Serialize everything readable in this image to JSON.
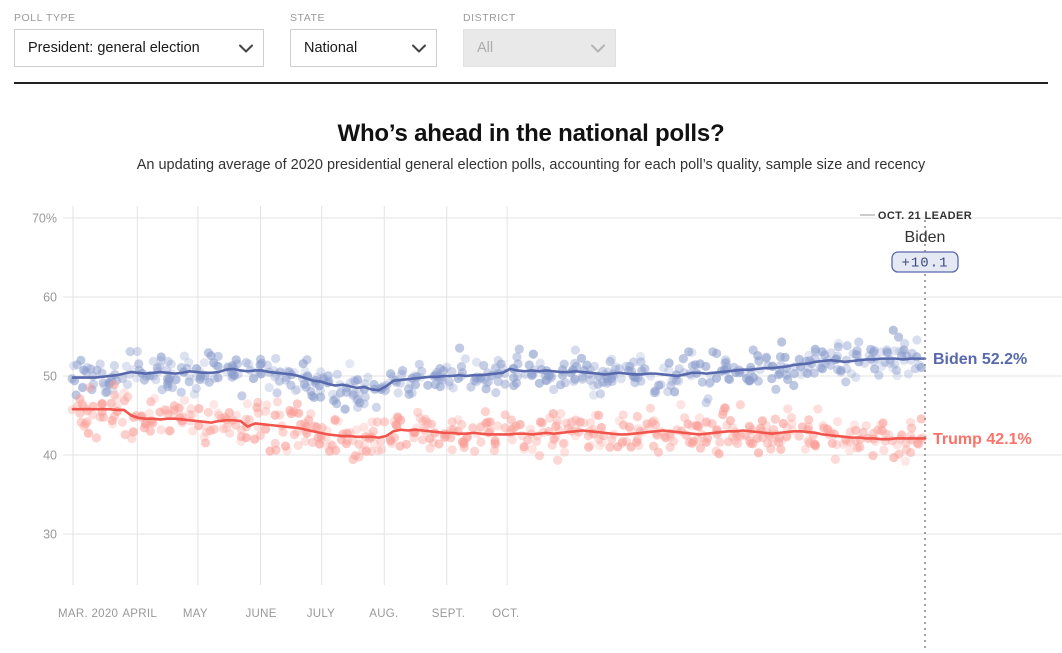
{
  "controls": [
    {
      "label": "POLL TYPE",
      "value": "President: general election",
      "disabled": false,
      "name": "poll-type"
    },
    {
      "label": "STATE",
      "value": "National",
      "disabled": false,
      "name": "state"
    },
    {
      "label": "DISTRICT",
      "value": "All",
      "disabled": true,
      "name": "district"
    }
  ],
  "header": {
    "title": "Who’s ahead in the national polls?",
    "subtitle": "An updating average of 2020 presidential general election polls, accounting for each poll’s quality, sample size and recency"
  },
  "annotation": {
    "kicker": "OCT. 21 LEADER",
    "leader": "Biden",
    "margin": "+10.1"
  },
  "colors": {
    "biden_line": "#5768ac",
    "biden_dot": "#8a9ccc",
    "trump_line": "#f0544b",
    "trump_dot": "#fa9d96",
    "grid": "#e3e3e3",
    "axis_text": "#999999",
    "rule": "#222222"
  },
  "chart_data": {
    "type": "line",
    "title": "Who’s ahead in the national polls?",
    "subtitle": "An updating average of 2020 presidential general election polls, accounting for each poll’s quality, sample size and recency",
    "xlabel": "",
    "ylabel": "",
    "ylim": [
      28,
      72
    ],
    "yticks": [
      30,
      40,
      50,
      60,
      70
    ],
    "ytick_labels": [
      "30",
      "40",
      "50",
      "60",
      "70%"
    ],
    "xticks": [
      "MAR. 2020",
      "APRIL",
      "MAY",
      "JUNE",
      "JULY",
      "AUG.",
      "SEPT.",
      "OCT."
    ],
    "grid": true,
    "legend_position": "right-inline",
    "marker_note": "Translucent scatter dots show individual polls behind each trend line",
    "series": [
      {
        "name": "Biden",
        "label": "Biden 52.2%",
        "final_value": 52.2,
        "color": "#5768ac",
        "values": [
          49.8,
          49.8,
          49.8,
          49.8,
          49.9,
          50.0,
          50.1,
          50.3,
          50.5,
          50.4,
          50.3,
          50.4,
          50.5,
          50.4,
          50.3,
          50.4,
          50.6,
          50.5,
          50.4,
          50.4,
          50.5,
          50.8,
          50.9,
          50.7,
          50.6,
          50.7,
          50.7,
          50.5,
          50.4,
          50.3,
          50.2,
          50.0,
          49.7,
          49.4,
          49.3,
          49.0,
          48.8,
          48.9,
          48.7,
          48.5,
          48.6,
          48.3,
          48.2,
          48.7,
          49.4,
          49.5,
          49.6,
          49.7,
          49.8,
          49.9,
          49.9,
          50.0,
          50.0,
          50.1,
          50.0,
          50.1,
          50.1,
          50.2,
          50.3,
          50.4,
          50.9,
          50.7,
          50.6,
          50.7,
          50.6,
          50.7,
          50.6,
          50.5,
          50.5,
          50.6,
          50.5,
          50.4,
          50.3,
          50.2,
          50.3,
          50.4,
          50.3,
          50.2,
          50.2,
          50.3,
          50.3,
          50.2,
          50.1,
          50.0,
          50.2,
          50.4,
          50.4,
          50.3,
          50.4,
          50.5,
          50.6,
          50.7,
          50.8,
          50.8,
          50.9,
          51.0,
          51.0,
          51.1,
          51.2,
          51.4,
          51.5,
          51.6,
          51.8,
          51.9,
          52.0,
          51.9,
          51.8,
          51.9,
          52.0,
          52.1,
          52.1,
          52.2,
          52.2,
          52.2,
          52.1,
          52.2,
          52.2,
          52.2
        ]
      },
      {
        "name": "Trump",
        "label": "Trump 42.1%",
        "final_value": 42.1,
        "color": "#f0544b",
        "values": [
          45.8,
          45.8,
          45.8,
          45.8,
          45.8,
          45.8,
          45.7,
          45.7,
          45.0,
          44.7,
          44.6,
          44.6,
          44.5,
          44.6,
          44.6,
          44.5,
          44.4,
          44.3,
          44.2,
          44.1,
          44.3,
          44.4,
          44.4,
          44.3,
          43.6,
          44.0,
          43.9,
          43.8,
          43.7,
          43.6,
          43.5,
          43.4,
          43.2,
          43.0,
          42.8,
          42.6,
          42.5,
          42.4,
          42.4,
          42.3,
          42.3,
          42.3,
          42.2,
          42.4,
          43.0,
          43.2,
          43.1,
          43.2,
          43.1,
          43.0,
          42.9,
          42.8,
          42.8,
          42.7,
          42.7,
          42.8,
          42.7,
          42.6,
          42.6,
          42.6,
          42.6,
          42.7,
          42.7,
          42.6,
          42.7,
          42.8,
          42.7,
          42.8,
          42.9,
          43.0,
          43.1,
          43.0,
          42.9,
          42.8,
          42.7,
          42.6,
          42.6,
          42.7,
          42.8,
          42.9,
          43.0,
          43.1,
          43.0,
          42.9,
          42.8,
          42.7,
          42.6,
          42.7,
          42.8,
          42.9,
          43.0,
          43.0,
          43.1,
          43.0,
          42.9,
          42.8,
          42.7,
          42.8,
          42.9,
          43.0,
          43.0,
          42.9,
          42.8,
          42.6,
          42.5,
          42.4,
          42.3,
          42.2,
          42.2,
          42.1,
          42.1,
          42.0,
          42.0,
          42.1,
          42.1,
          42.1,
          42.1,
          42.1
        ]
      }
    ]
  }
}
